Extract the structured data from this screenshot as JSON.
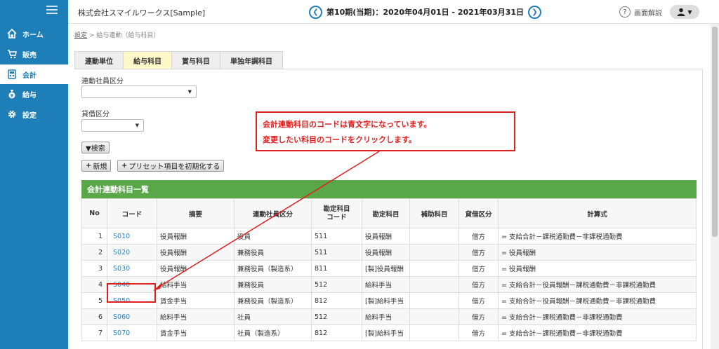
{
  "sidebar": {
    "items": [
      {
        "label": "ホーム",
        "icon": "home-icon"
      },
      {
        "label": "販売",
        "icon": "cart-icon"
      },
      {
        "label": "会計",
        "icon": "calculator-icon"
      },
      {
        "label": "給与",
        "icon": "moneybag-icon"
      },
      {
        "label": "設定",
        "icon": "gear-icon"
      }
    ],
    "active": "会計"
  },
  "header": {
    "company": "株式会社スマイルワークス[Sample]",
    "period": "第10期(当期)：2020年04月01日 - 2021年03月31日",
    "help_label": "画面解説"
  },
  "breadcrumb": {
    "root": "設定",
    "separator": ">",
    "current": "給与連動（給与科目）"
  },
  "tabs": [
    "連動単位",
    "給与科目",
    "賞与科目",
    "単独年調科目"
  ],
  "active_tab": "給与科目",
  "filters": {
    "employee_type_label": "連動社員区分",
    "debit_credit_label": "貸借区分"
  },
  "buttons": {
    "search": "▼検索",
    "new": "新規",
    "reset_preset": "プリセット項目を初期化する"
  },
  "list": {
    "title": "会計連動科目一覧",
    "columns": [
      "No",
      "コード",
      "摘要",
      "連動社員区分",
      "勘定科目\nコード",
      "勘定科目",
      "補助科目",
      "貸借区分",
      "計算式"
    ],
    "rows": [
      {
        "no": "1",
        "code": "S010",
        "summary": "役員報酬",
        "emp_type": "役員",
        "acct_code": "511",
        "acct": "役員報酬",
        "sub": "",
        "dc": "借方",
        "formula": "= 支給合計－課税通勤費－非課税通勤費"
      },
      {
        "no": "2",
        "code": "S020",
        "summary": "役員報酬",
        "emp_type": "兼務役員",
        "acct_code": "511",
        "acct": "役員報酬",
        "sub": "",
        "dc": "借方",
        "formula": "= 役員報酬"
      },
      {
        "no": "3",
        "code": "S030",
        "summary": "役員報酬",
        "emp_type": "兼務役員（製造系）",
        "acct_code": "811",
        "acct": "[製]役員報酬",
        "sub": "",
        "dc": "借方",
        "formula": "= 役員報酬"
      },
      {
        "no": "4",
        "code": "S040",
        "summary": "給料手当",
        "emp_type": "兼務役員",
        "acct_code": "512",
        "acct": "給料手当",
        "sub": "",
        "dc": "借方",
        "formula": "= 支給合計－役員報酬－課税通勤費－非課税通勤費"
      },
      {
        "no": "5",
        "code": "S050",
        "summary": "賃金手当",
        "emp_type": "兼務役員（製造系）",
        "acct_code": "812",
        "acct": "[製]給料手当",
        "sub": "",
        "dc": "借方",
        "formula": "= 支給合計－役員報酬－課税通勤費－非課税通勤費"
      },
      {
        "no": "6",
        "code": "S060",
        "summary": "給料手当",
        "emp_type": "社員",
        "acct_code": "512",
        "acct": "給料手当",
        "sub": "",
        "dc": "借方",
        "formula": "= 支給合計－課税通勤費－非課税通勤費"
      },
      {
        "no": "7",
        "code": "S070",
        "summary": "賃金手当",
        "emp_type": "社員（製造系）",
        "acct_code": "812",
        "acct": "[製]給料手当",
        "sub": "",
        "dc": "借方",
        "formula": "= 支給合計－課税通勤費－非課税通勤費"
      }
    ]
  },
  "annotation": {
    "line1": "会計連動科目のコードは青文字になっています。",
    "line2": "変更したい科目のコードをクリックします。"
  },
  "colors": {
    "sidebar": "#1e7fb8",
    "list_header": "#5aa74a",
    "code_link": "#2a85c8",
    "annotation": "#e02020",
    "active_tab": "#fff8c8"
  }
}
